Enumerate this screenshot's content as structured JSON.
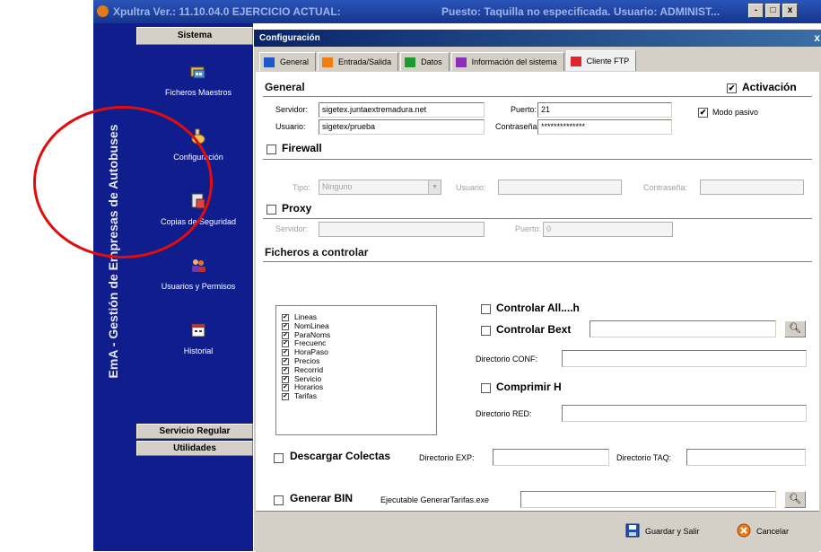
{
  "app": {
    "title_left": "Xpultra Ver.: 11.10.04.0 EJERCICIO ACTUAL:",
    "title_right": "Puesto: Taquilla no especificada. Usuario: ADMINIST...",
    "window_buttons": [
      "-",
      "□",
      "x"
    ],
    "vertical_title": "EmA - Gestión de Empresas de Autobuses",
    "sidebar_header": "Sistema",
    "menu": [
      {
        "label": "Ficheros Maestros",
        "icon": "folders-icon"
      },
      {
        "label": "Configuración",
        "icon": "hand-config-icon"
      },
      {
        "label": "Copias de Seguridad",
        "icon": "backup-icon"
      },
      {
        "label": "Usuarios y Permisos",
        "icon": "users-icon"
      },
      {
        "label": "Historial",
        "icon": "calendar-icon"
      }
    ],
    "bottom_buttons": [
      "Servicio Regular",
      "Utilidades"
    ]
  },
  "dialog": {
    "title": "Configuración",
    "close": "x",
    "tabs": [
      {
        "label": "General",
        "color": "#1f57c9"
      },
      {
        "label": "Entrada/Salida",
        "color": "#f07d12"
      },
      {
        "label": "Datos",
        "color": "#1d9b2f"
      },
      {
        "label": "Información del sistema",
        "color": "#8a2fb8"
      },
      {
        "label": "Cliente FTP",
        "color": "#e0242c"
      }
    ],
    "general": {
      "heading": "General",
      "activacion_label": "Activación",
      "activacion_checked": true,
      "servidor_label": "Servidor:",
      "servidor_value": "sigetex.juntaextremadura.net",
      "usuario_label": "Usuario:",
      "usuario_value": "sigetex/prueba",
      "puerto_label": "Puerto:",
      "puerto_value": "21",
      "contrasena_label": "Contraseña:",
      "contrasena_value": "**************",
      "modo_pasivo_label": "Modo pasivo",
      "modo_pasivo_checked": true
    },
    "firewall": {
      "label": "Firewall",
      "checked": false,
      "tipo_label": "Tipo:",
      "tipo_value": "Ninguno",
      "usuario_label": "Usuario:",
      "contrasena_label": "Contraseña:"
    },
    "proxy": {
      "label": "Proxy",
      "checked": false,
      "servidor_label": "Servidor:",
      "puerto_label": "Puerto:",
      "puerto_value": "0"
    },
    "ficheros": {
      "heading": "Ficheros a controlar",
      "items": [
        "Lineas",
        "NomLinea",
        "ParaNoms",
        "Frecuenc",
        "HoraPaso",
        "Precios",
        "Recorrid",
        "Servicio",
        "Horarios",
        "Tarifas"
      ],
      "controlar_all_label": "Controlar All....h",
      "controlar_bext_label": "Controlar Bext",
      "directorio_conf_label": "Directorio CONF:",
      "comprimir_label": "Comprimir H",
      "directorio_red_label": "Directorio RED:"
    },
    "descargar": {
      "label": "Descargar Colectas",
      "dir_exp_label": "Directorio EXP:",
      "dir_taq_label": "Directorio TAQ:"
    },
    "generar": {
      "label": "Generar BIN",
      "exe_label": "Ejecutable GenerarTarifas.exe"
    },
    "buttons": {
      "save": "Guardar y Salir",
      "cancel": "Cancelar"
    }
  }
}
